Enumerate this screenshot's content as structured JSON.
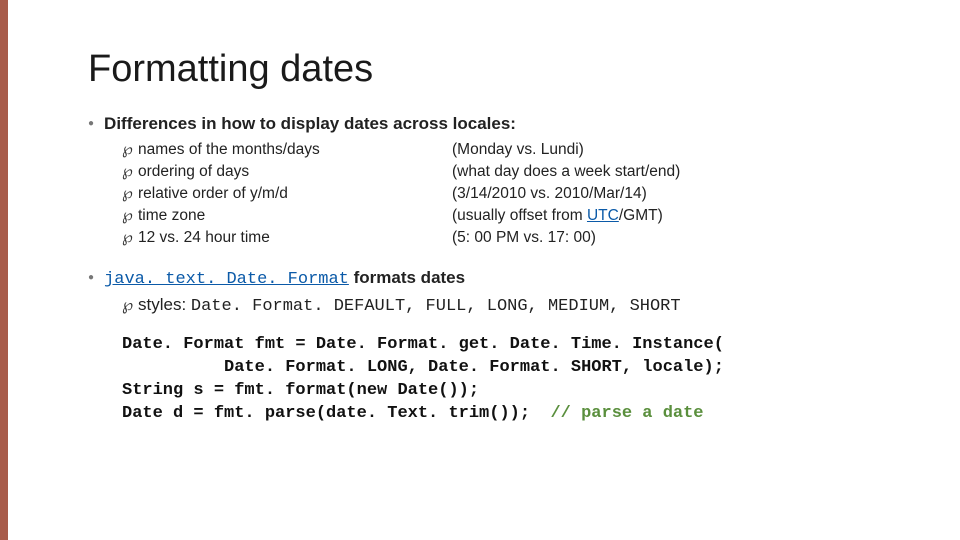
{
  "title": "Formatting dates",
  "section1": {
    "lead": "Differences in how to display dates across locales:",
    "items": [
      {
        "left": "names of the months/days",
        "right": "(Monday vs. Lundi)"
      },
      {
        "left": "ordering of days",
        "right": "(what day does a week start/end)"
      },
      {
        "left": "relative order of y/m/d",
        "right": "(3/14/2010 vs. 2010/Mar/14)"
      },
      {
        "left": "time zone",
        "right_pre": "(usually offset from ",
        "right_link": "UTC",
        "right_post": "/GMT)"
      },
      {
        "left": "12 vs. 24 hour time",
        "right": "(5: 00 PM vs. 17: 00)"
      }
    ]
  },
  "section2": {
    "lead_link": "java. text. Date. Format",
    "lead_post": " formats dates",
    "styles_label": "styles: ",
    "styles_vals": "Date. Format. DEFAULT, FULL, LONG, MEDIUM, SHORT",
    "code_l1": "Date. Format fmt = Date. Format. get. Date. Time. Instance(",
    "code_l2": "          Date. Format. LONG, Date. Format. SHORT, locale);",
    "code_l3": "String s = fmt. format(new Date());",
    "code_l4a": "Date d = fmt. parse(date. Text. trim());  ",
    "code_l4b": "// parse a date"
  }
}
